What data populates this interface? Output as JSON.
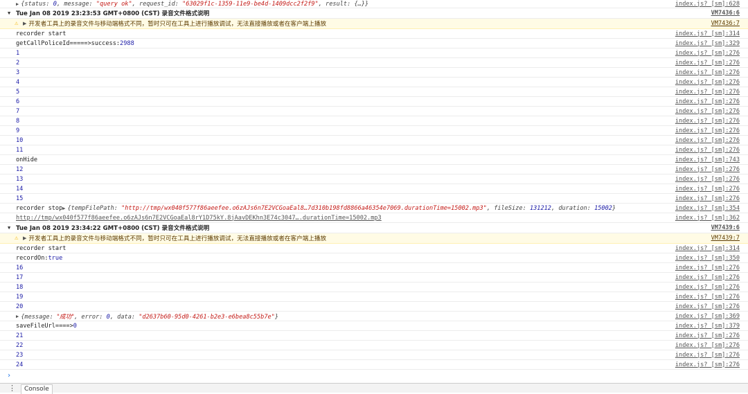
{
  "console": {
    "obj1": {
      "text_pre": "{status: ",
      "status": "0",
      "t2": ", message: ",
      "message": "\"query ok\"",
      "t3": ", request_id: ",
      "request_id": "\"63029f1c-1359-11e9-be4d-1409dcc2f2f9\"",
      "t4": ", result: {…}}",
      "src": "index.js? [sm]:628"
    },
    "group1": {
      "title": "Tue Jan 08 2019 23:23:53 GMT+0800 (CST) 录音文件格式说明",
      "src": "VM7436:6"
    },
    "warn1": {
      "text": "开发者工具上的录音文件与移动端格式不同，暂时只可在工具上进行播放调试，无法直接播放或者在客户端上播放",
      "src": "VM7436:7"
    },
    "rec_start1": {
      "text": "recorder start",
      "src": "index.js? [sm]:314"
    },
    "callpolice": {
      "text": "getCallPoliceId=====>success: ",
      "value": "2988",
      "src": "index.js? [sm]:329"
    },
    "counts_a": [
      {
        "v": "1",
        "src": "index.js? [sm]:276"
      },
      {
        "v": "2",
        "src": "index.js? [sm]:276"
      },
      {
        "v": "3",
        "src": "index.js? [sm]:276"
      },
      {
        "v": "4",
        "src": "index.js? [sm]:276"
      },
      {
        "v": "5",
        "src": "index.js? [sm]:276"
      },
      {
        "v": "6",
        "src": "index.js? [sm]:276"
      },
      {
        "v": "7",
        "src": "index.js? [sm]:276"
      },
      {
        "v": "8",
        "src": "index.js? [sm]:276"
      },
      {
        "v": "9",
        "src": "index.js? [sm]:276"
      },
      {
        "v": "10",
        "src": "index.js? [sm]:276"
      },
      {
        "v": "11",
        "src": "index.js? [sm]:276"
      }
    ],
    "onhide": {
      "text": "onHide",
      "src": "index.js? [sm]:743"
    },
    "counts_b": [
      {
        "v": "12",
        "src": "index.js? [sm]:276"
      },
      {
        "v": "13",
        "src": "index.js? [sm]:276"
      },
      {
        "v": "14",
        "src": "index.js? [sm]:276"
      },
      {
        "v": "15",
        "src": "index.js? [sm]:276"
      }
    ],
    "rec_stop": {
      "label": "recorder stop ",
      "t1": "{tempFilePath: ",
      "path": "\"http://tmp/wx040f577f86aeefee.o6zAJs6n7E2VCGoaEal8…7d310b198fd8866a46354e7069.durationTime=15002.mp3\"",
      "t2": ", fileSize: ",
      "filesize": "131212",
      "t3": ", duration: ",
      "duration": "15002",
      "t4": "}",
      "src": "index.js? [sm]:354"
    },
    "url_row": {
      "text": "http://tmp/wx040f577f86aeefee.o6zAJs6n7E2VCGoaEal8rY1D75kY.8jAavDEKhn3E74c3047….durationTime=15002.mp3",
      "src": "index.js? [sm]:362"
    },
    "group2": {
      "title": "Tue Jan 08 2019 23:34:22 GMT+0800 (CST) 录音文件格式说明",
      "src": "VM7439:6"
    },
    "warn2": {
      "text": "开发者工具上的录音文件与移动端格式不同，暂时只可在工具上进行播放调试，无法直接播放或者在客户端上播放",
      "src": "VM7439:7"
    },
    "rec_start2": {
      "text": "recorder start",
      "src": "index.js? [sm]:314"
    },
    "recordon": {
      "text": "recordOn: ",
      "value": "true",
      "src": "index.js? [sm]:350"
    },
    "counts_c": [
      {
        "v": "16",
        "src": "index.js? [sm]:276"
      },
      {
        "v": "17",
        "src": "index.js? [sm]:276"
      },
      {
        "v": "18",
        "src": "index.js? [sm]:276"
      },
      {
        "v": "19",
        "src": "index.js? [sm]:276"
      },
      {
        "v": "20",
        "src": "index.js? [sm]:276"
      }
    ],
    "obj2": {
      "t1": "{message: ",
      "message": "\"成功\"",
      "t2": ", error: ",
      "error": "0",
      "t3": ", data: ",
      "data": "\"d2637b60-95d0-4261-b2e3-e6bea8c55b7e\"",
      "t4": "}",
      "src": "index.js? [sm]:369"
    },
    "savefile": {
      "text": "saveFileUrl====> ",
      "value": "0",
      "src": "index.js? [sm]:379"
    },
    "counts_d": [
      {
        "v": "21",
        "src": "index.js? [sm]:276"
      },
      {
        "v": "22",
        "src": "index.js? [sm]:276"
      },
      {
        "v": "23",
        "src": "index.js? [sm]:276"
      },
      {
        "v": "24",
        "src": "index.js? [sm]:276"
      }
    ],
    "prompt": "›"
  },
  "drawer": {
    "menu": "⋮",
    "tab": "Console"
  },
  "colors": {
    "number": "#1a1aa6",
    "string": "#c41a16",
    "warn_bg": "#fffbe5",
    "warn_icon": "#f4b400"
  }
}
